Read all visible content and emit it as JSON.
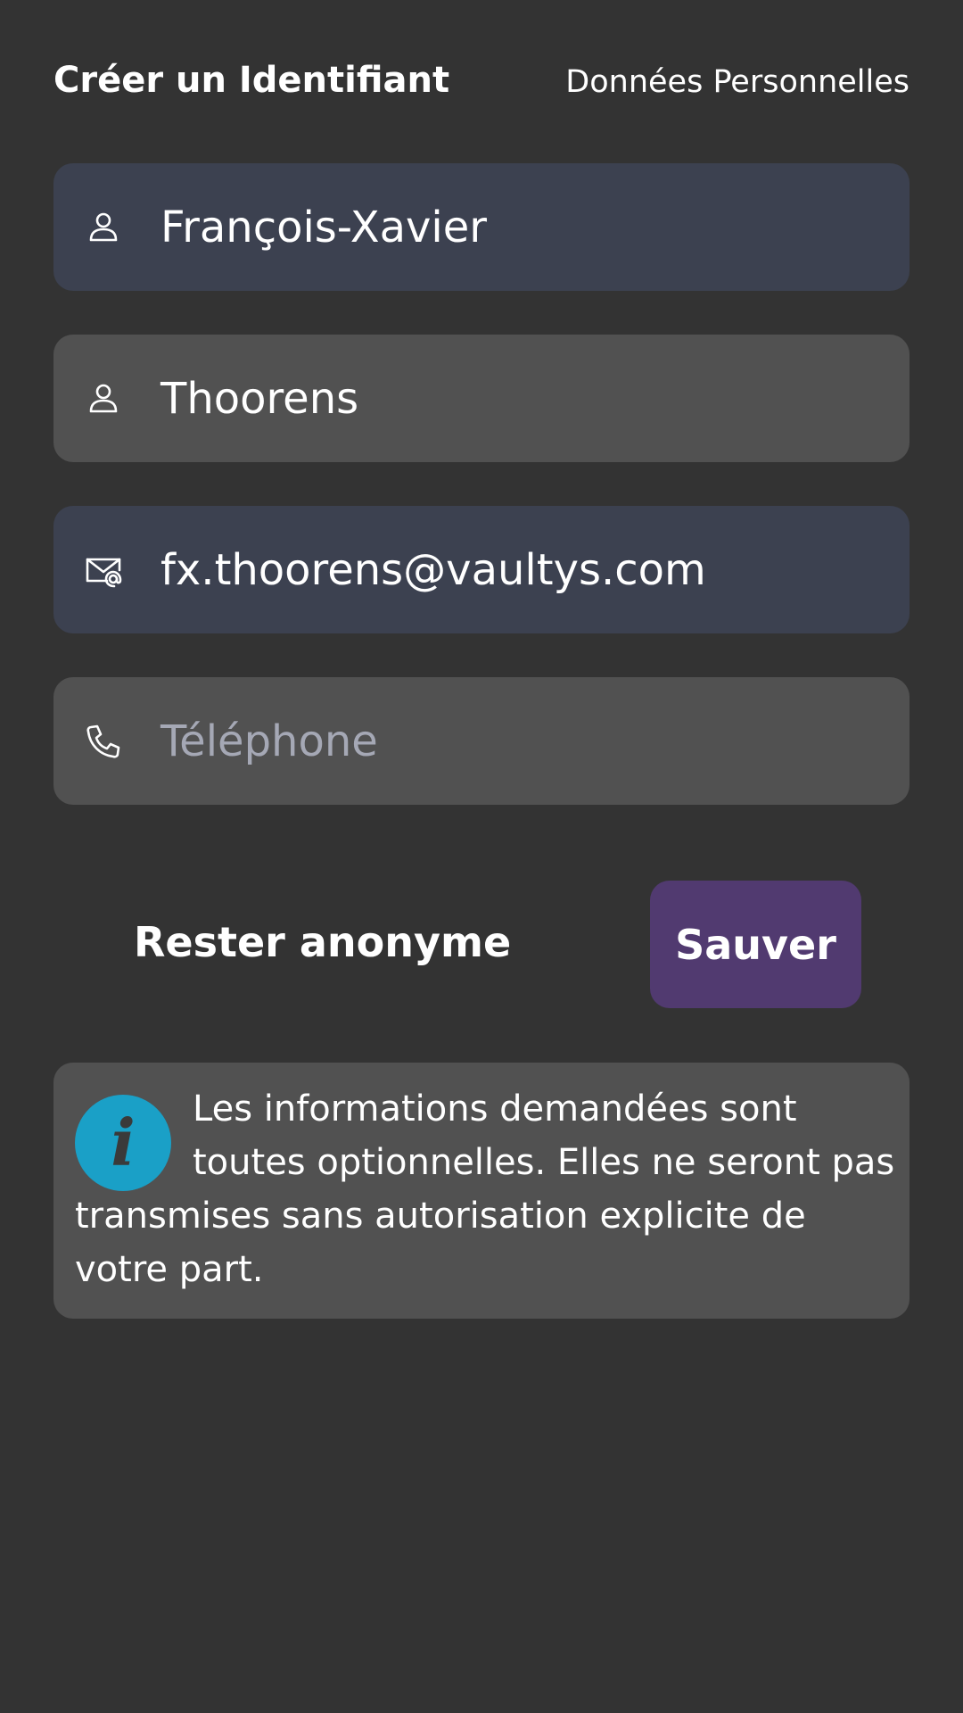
{
  "header": {
    "title": "Créer un Identifiant",
    "subtitle": "Données Personnelles"
  },
  "fields": [
    {
      "icon": "person-icon",
      "value": "François-Xavier",
      "filled": true
    },
    {
      "icon": "person-icon",
      "value": "Thoorens",
      "filled": false
    },
    {
      "icon": "email-icon",
      "value": "fx.thoorens@vaultys.com",
      "filled": true
    },
    {
      "icon": "phone-icon",
      "value": "",
      "placeholder": "Téléphone",
      "filled": false
    }
  ],
  "actions": {
    "anonymous_label": "Rester anonyme",
    "save_label": "Sauver"
  },
  "info": {
    "icon_glyph": "i",
    "text": "Les informations demandées sont toutes optionnelles. Elles ne seront pas transmises sans autorisation explicite de votre part."
  },
  "colors": {
    "background": "#333333",
    "field_default": "#515151",
    "field_filled": "#3c4150",
    "save_button": "#513a70",
    "info_icon": "#1aa0c7",
    "placeholder": "#a5a8b5"
  }
}
